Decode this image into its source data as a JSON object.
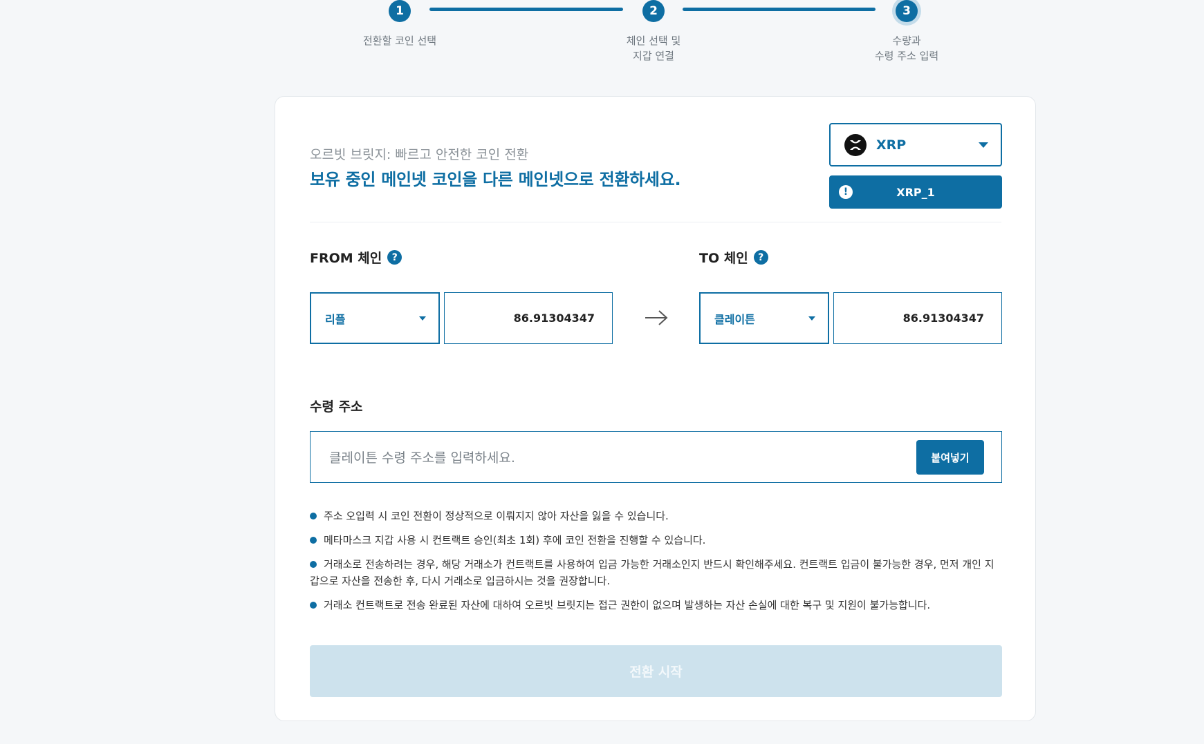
{
  "stepper": {
    "steps": [
      {
        "number": "1",
        "label": "전환할 코인 선택"
      },
      {
        "number": "2",
        "label": "체인 선택 및\n지갑 연결"
      },
      {
        "number": "3",
        "label": "수량과\n수령 주소 입력"
      }
    ],
    "current_step": 3
  },
  "header": {
    "subtitle": "오르빗 브릿지: 빠르고 안전한 코인 전환",
    "title": "보유 중인 메인넷 코인을 다른 메인넷으로 전환하세요."
  },
  "coin_select": {
    "selected": "XRP",
    "icon": "xrp-logo-icon"
  },
  "wallet": {
    "label": "XRP_1",
    "icon": "alert-icon"
  },
  "from": {
    "label": "FROM 체인",
    "help_icon": "?",
    "chain": "리플",
    "amount": "86.91304347"
  },
  "to": {
    "label": "TO 체인",
    "help_icon": "?",
    "chain": "클레이튼",
    "amount": "86.91304347"
  },
  "address": {
    "label": "수령 주소",
    "placeholder": "클레이튼 수령 주소를 입력하세요.",
    "value": "",
    "paste_label": "붙여넣기"
  },
  "notes": [
    "주소 오입력 시 코인 전환이 정상적으로 이뤄지지 않아 자산을 잃을 수 있습니다.",
    "메타마스크 지갑 사용 시 컨트랙트 승인(최초 1회) 후에 코인 전환을 진행할 수 있습니다.",
    "거래소로 전송하려는 경우, 해당 거래소가 컨트랙트를 사용하여 입금 가능한 거래소인지 반드시 확인해주세요. 컨트랙트 입금이 불가능한 경우, 먼저 개인 지갑으로 자산을 전송한 후, 다시 거래소로 입금하시는 것을 권장합니다.",
    "거래소 컨트랙트로 전송 완료된 자산에 대하여 오르빗 브릿지는 접근 권한이 없으며 발생하는 자산 손실에 대한 복구 및 지원이 불가능합니다."
  ],
  "start_button": {
    "label": "전환 시작",
    "enabled": false
  },
  "colors": {
    "accent": "#0e6ea3",
    "background": "#f5f7f9",
    "disabled_button": "#cde2ed"
  }
}
